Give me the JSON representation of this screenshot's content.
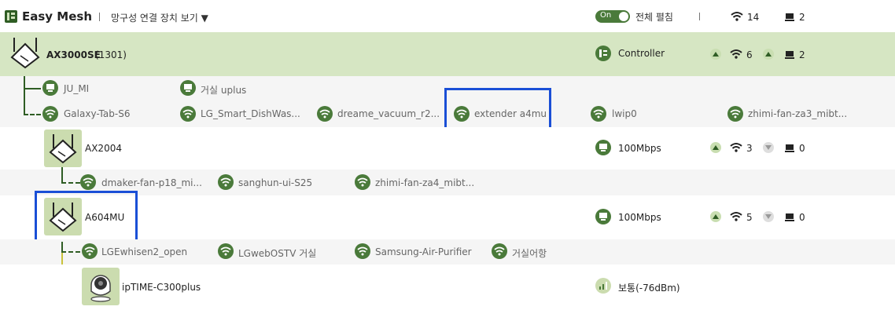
{
  "header": {
    "title": "Easy Mesh",
    "view_link": "망구성 연결 장치 보기 ▼",
    "toggle_label": "On",
    "expand_all": "전체 펼침",
    "total_wifi": "14",
    "total_lan": "2"
  },
  "controller": {
    "name": "AX3000SE",
    "id": "(1301)",
    "role": "Controller",
    "wifi_count": "6",
    "lan_count": "2",
    "lan_clients": [
      "JU_MI",
      "거실 uplus"
    ],
    "wifi_clients": [
      "Galaxy-Tab-S6",
      "LG_Smart_DishWas...",
      "dreame_vacuum_r2...",
      "extender a4mu",
      "lwip0",
      "zhimi-fan-za3_mibt..."
    ]
  },
  "nodes": [
    {
      "name": "AX2004",
      "link": "100Mbps",
      "wifi_count": "3",
      "lan_count": "0",
      "wifi_clients": [
        "dmaker-fan-p18_mi...",
        "sanghun-ui-S25",
        "zhimi-fan-za4_mibt..."
      ]
    },
    {
      "name": "A604MU",
      "link": "100Mbps",
      "wifi_count": "5",
      "lan_count": "0",
      "wifi_clients": [
        "LGEwhisen2_open",
        "LGwebOSTV 거실",
        "Samsung-Air-Purifier",
        "거실어항"
      ]
    }
  ],
  "camera": {
    "name": "ipTIME-C300plus",
    "signal": "보통(-76dBm)"
  },
  "colors": {
    "accent": "#4a7a3a",
    "controller_row": "#d6e6c3",
    "highlight_box": "#1a4fd6"
  }
}
